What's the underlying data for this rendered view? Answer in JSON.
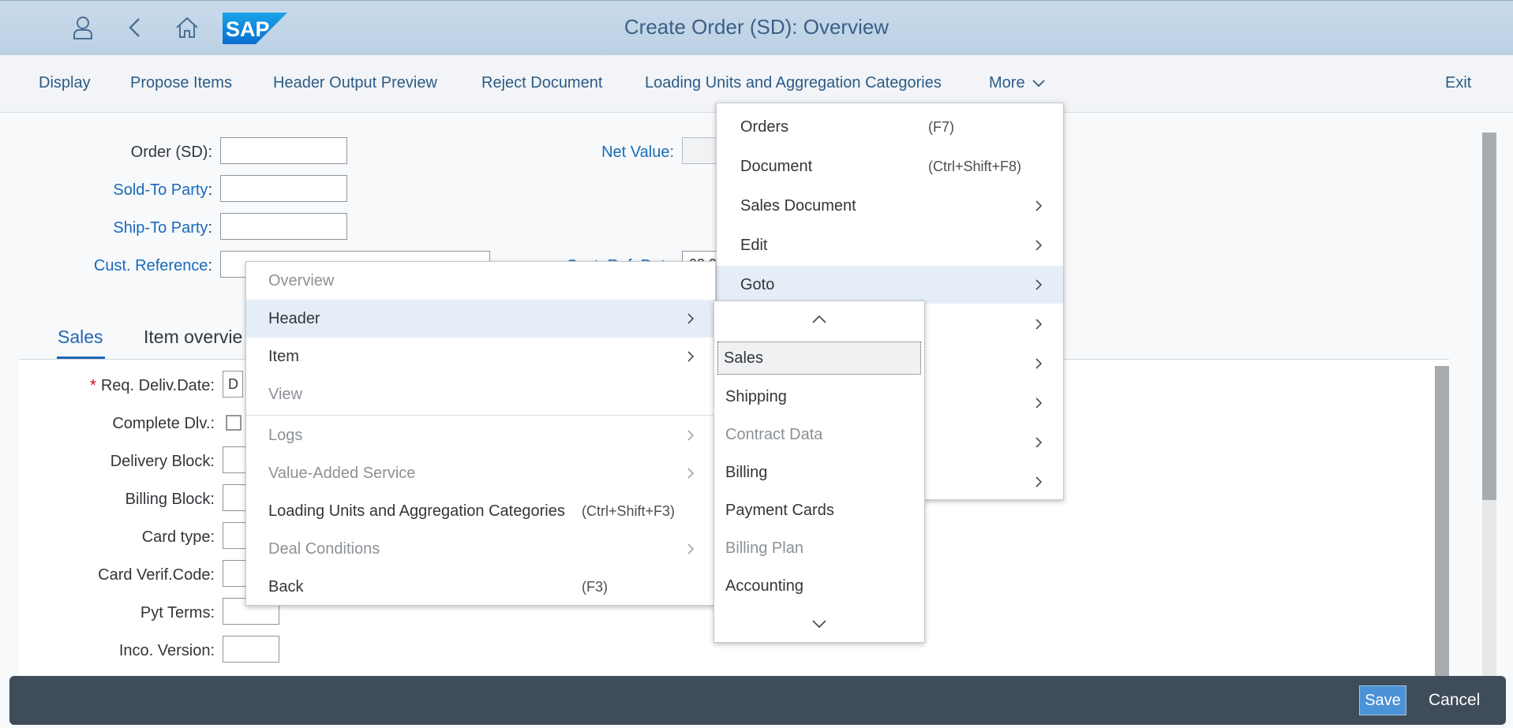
{
  "shell": {
    "title": "Create Order (SD): Overview",
    "logo_text": "SAP",
    "icons": [
      "user-icon",
      "back-icon",
      "home-icon"
    ]
  },
  "toolbar": {
    "display": "Display",
    "propose_items": "Propose Items",
    "header_output_preview": "Header Output Preview",
    "reject_document": "Reject Document",
    "loading_units": "Loading Units and Aggregation Categories",
    "more": "More",
    "exit": "Exit"
  },
  "form": {
    "order_sd": "Order (SD):",
    "sold_to": "Sold-To Party",
    "ship_to": "Ship-To Party",
    "cust_ref": "Cust. Reference",
    "colon": ":",
    "net_value": "Net Value:",
    "cust_ref_date": "Cust. Ref. Date",
    "cust_ref_date_value": "03.0"
  },
  "tabs": {
    "sales": "Sales",
    "item_overview": "Item overvie"
  },
  "sales_fields": {
    "req_deliv_date": "Req. Deliv.Date:",
    "req_deliv_value": "D",
    "complete_dlv": "Complete Dlv.:",
    "delivery_block": "Delivery Block:",
    "billing_block": "Billing Block:",
    "card_type": "Card type:",
    "card_verif": "Card Verif.Code:",
    "pyt_terms": "Pyt Terms:",
    "inco_version": "Inco. Version:"
  },
  "more_menu": {
    "orders": "Orders",
    "orders_sc": "(F7)",
    "document": "Document",
    "document_sc": "(Ctrl+Shift+F8)",
    "sales_document": "Sales Document",
    "edit": "Edit",
    "goto": "Goto"
  },
  "goto_menu": {
    "overview": "Overview",
    "header": "Header",
    "item": "Item",
    "view": "View",
    "logs": "Logs",
    "value_added": "Value-Added Service",
    "loading_units": "Loading Units and Aggregation Categories",
    "loading_units_sc": "(Ctrl+Shift+F3)",
    "deal_conditions": "Deal Conditions",
    "back": "Back",
    "back_sc": "(F3)"
  },
  "header_menu": {
    "sales": "Sales",
    "shipping": "Shipping",
    "contract_data": "Contract Data",
    "billing": "Billing",
    "payment_cards": "Payment Cards",
    "billing_plan": "Billing Plan",
    "accounting": "Accounting"
  },
  "footer": {
    "save": "Save",
    "cancel": "Cancel"
  },
  "colors": {
    "accent": "#2166b0",
    "link": "#1a6ab8",
    "footer": "#3f4c5a",
    "save": "#4b92d6"
  }
}
